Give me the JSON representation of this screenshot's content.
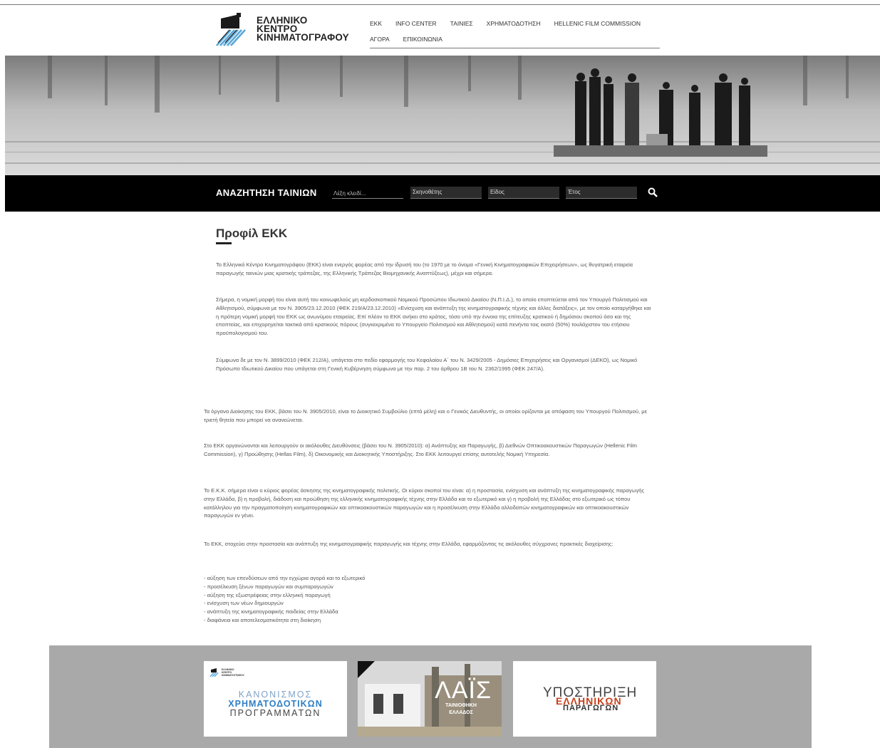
{
  "header": {
    "logo_lines": [
      "ΕΛΛΗΝΙΚΟ",
      "ΚΕΝΤΡΟ",
      "ΚΙΝΗΜΑΤΟΓΡΑΦΟΥ"
    ],
    "nav_row1": [
      "ΕΚΚ",
      "INFO CENTER",
      "ΤΑΙΝΙΕΣ",
      "ΧΡΗΜΑΤΟΔΟΤΗΣΗ",
      "HELLENIC FILM COMMISSION"
    ],
    "nav_row2": [
      "ΑΓΟΡΑ",
      "ΕΠΙΚΟΙΝΩΝΙΑ"
    ]
  },
  "search": {
    "title": "ΑΝΑΖΗΤΗΣΗ ΤΑΙΝΙΩΝ",
    "keyword_placeholder": "Λέξη κλειδί...",
    "director_label": "Σκηνοθέτης",
    "genre_label": "Είδος",
    "year_label": "Έτος",
    "search_icon": "search-icon"
  },
  "main": {
    "title_prefix": "Προφίλ",
    "title_bold": "ΕΚΚ",
    "paragraphs": [
      "Το Ελληνικό Κέντρο Κινηματογράφου (ΕΚΚ) είναι ενεργός φορέας από την ίδρυσή του (το 1970 με το όνομα «Γενική Κινηματογραφικών Επιχειρήσεων», ως θυγατρική εταιρεία παραγωγής ταινιών μιας κρατικής τράπεζας, της Ελληνικής Τράπεζας Βιομηχανικής Αναπτύξεως), μέχρι και σήμερα.",
      "Σήμερα, η νομική μορφή του είναι αυτή του κοινωφελούς μη κερδοσκοπικού Νομικού Προσώπου Ιδιωτικού Δικαίου (Ν.Π.Ι.Δ.), το οποίο εποπτεύεται από τον Υπουργό Πολιτισμού και Αθλητισμού, σύμφωνα με τον Ν. 3905/23.12.2010 (ΦΕΚ 219/Α/23.12.2010) «Ενίσχυση και ανάπτυξη της κινηματογραφικής τέχνης και άλλες διατάξεις», με τον οποίο καταργήθηκε και η πρότερη νομική μορφή του ΕΚΚ ως ανωνύμου εταιρείας. Επί πλέον το ΕΚΚ ανήκει στο κράτος, τόσο υπό την έννοια της επίτευξης κρατικού ή δημόσιου σκοπού όσο και της εποπτείας, και επιχορηγείται τακτικά από κρατικούς πόρους (συγκεκριμένα το Υπουργείο Πολιτισμού και Αθλητισμού) κατά πενήντα τοις εκατό (50%) τουλάχιστον του ετήσιου προϋπολογισμού του.",
      "Σύμφωνα δε με τον Ν. 3899/2010 (ΦΕΚ 212/Α), υπάγεται στο πεδίο εφαρμογής του Κεφαλαίου Α΄ του Ν. 3429/2005 - Δημόσιες Επιχειρήσεις και Οργανισμοί (ΔΕΚΟ), ως Νομικό Πρόσωπο Ιδιωτικού Δικαίου που υπάγεται στη Γενική Κυβέρνηση σύμφωνα με την παρ. 2 του άρθρου 1Β του Ν. 2362/1995 (ΦΕΚ 247/Α).",
      "Τα όργανα Διοίκησης του ΕΚΚ, βάσει του Ν. 3905/2010, είναι το Διοικητικό Συμβούλιο (επτά μέλη) και ο Γενικός Διευθυντής, οι οποίοι ορίζονται με απόφαση του Υπουργού Πολιτισμού, με τριετή θητεία που μπορεί να ανανεώνεται.",
      "Στο ΕΚΚ οργανώνονται και λειτουργούν οι ακόλουθες Διευθύνσεις (βάσει του Ν. 3905/2010): α) Ανάπτυξης και Παραγωγής, β) Διεθνών Οπτικοακουστικών Παραγωγών (Hellenic Film Commission), γ) Προώθησης (Hellas Film), δ) Οικονομικής και Διοικητικής Υποστήριξης. Στο ΕΚΚ λειτουργεί επίσης αυτοτελής Νομική Υπηρεσία.",
      "Το Ε.Κ.Κ. σήμερα είναι ο κύριος φορέας άσκησης της κινηματογραφικής πολιτικής. Οι κύριοι σκοποί του είναι: α) η προστασία, ενίσχυση και ανάπτυξη της κινηματογραφικής παραγωγής στην Ελλάδα, β) η προβολή, διάδοση και προώθηση της ελληνικής κινηματογραφικής τέχνης στην Ελλάδα και το εξωτερικό και γ) η προβολή της Ελλάδας στο εξωτερικό ως τόπου κατάλληλου για την πραγματοποίηση κινηματογραφικών και οπτικοακουστικών παραγωγών και η προσέλκυση στην Ελλάδα αλλοδαπών κινηματογραφικών και οπτικοακουστικών παραγωγών εν γένει.",
      "Το ΕΚΚ, στοχεύει στην προστασία και ανάπτυξη της κινηματογραφικής παραγωγής και τέχνης στην Ελλάδα, εφαρμόζοντας τις ακόλουθες σύγχρονες πρακτικές διαχείρισης:"
    ],
    "list": [
      "- αύξηση των επενδύσεων από την εγχώρια αγορά και το εξωτερικό",
      "- προσέλκυση ξένων παραγωγών και συμπαραγωγών",
      "- αύξηση της εξωστρέφειας στην ελληνική παραγωγή",
      "- ενίσχυση των νέων δημιουργών",
      "- ανάπτυξη της κινηματογραφικής παιδείας στην Ελλάδα",
      "- διαφάνεια και αποτελεσματικότητα στη διοίκηση"
    ]
  },
  "footer": {
    "banner1": {
      "logo_lines": [
        "ΕΛΛΗΝΙΚΟ",
        "ΚΕΝΤΡΟ",
        "ΚΙΝΗΜΑΤΟΓΡΑΦΟΥ"
      ],
      "lines": [
        "ΚΑΝΟΝΙΣΜΟΣ",
        "ΧΡΗΜΑΤΟΔΟΤΙΚΩΝ",
        "ΠΡΟΓΡΑΜΜΑΤΩΝ"
      ],
      "colors": [
        "#7fa3c8",
        "#2f7fc4",
        "#444444"
      ]
    },
    "banner2": {
      "title": "ΛΑΪΣ",
      "sub": [
        "ΤΑΙΝΙΟΘΗΚΗ",
        "ΕΛΛΑΔΟΣ"
      ]
    },
    "banner3": {
      "lines": [
        "ΥΠΟΣΤΗΡΙΞΗ",
        "ΕΛΛΗΝΙΚΩΝ",
        "ΠΑΡΑΓΩΓΩΝ"
      ]
    }
  },
  "colors": {
    "search_bar": "#000000",
    "footer_bg": "#a9a9a9",
    "accent_blue": "#2f7fc4",
    "accent_red": "#c8401a"
  }
}
